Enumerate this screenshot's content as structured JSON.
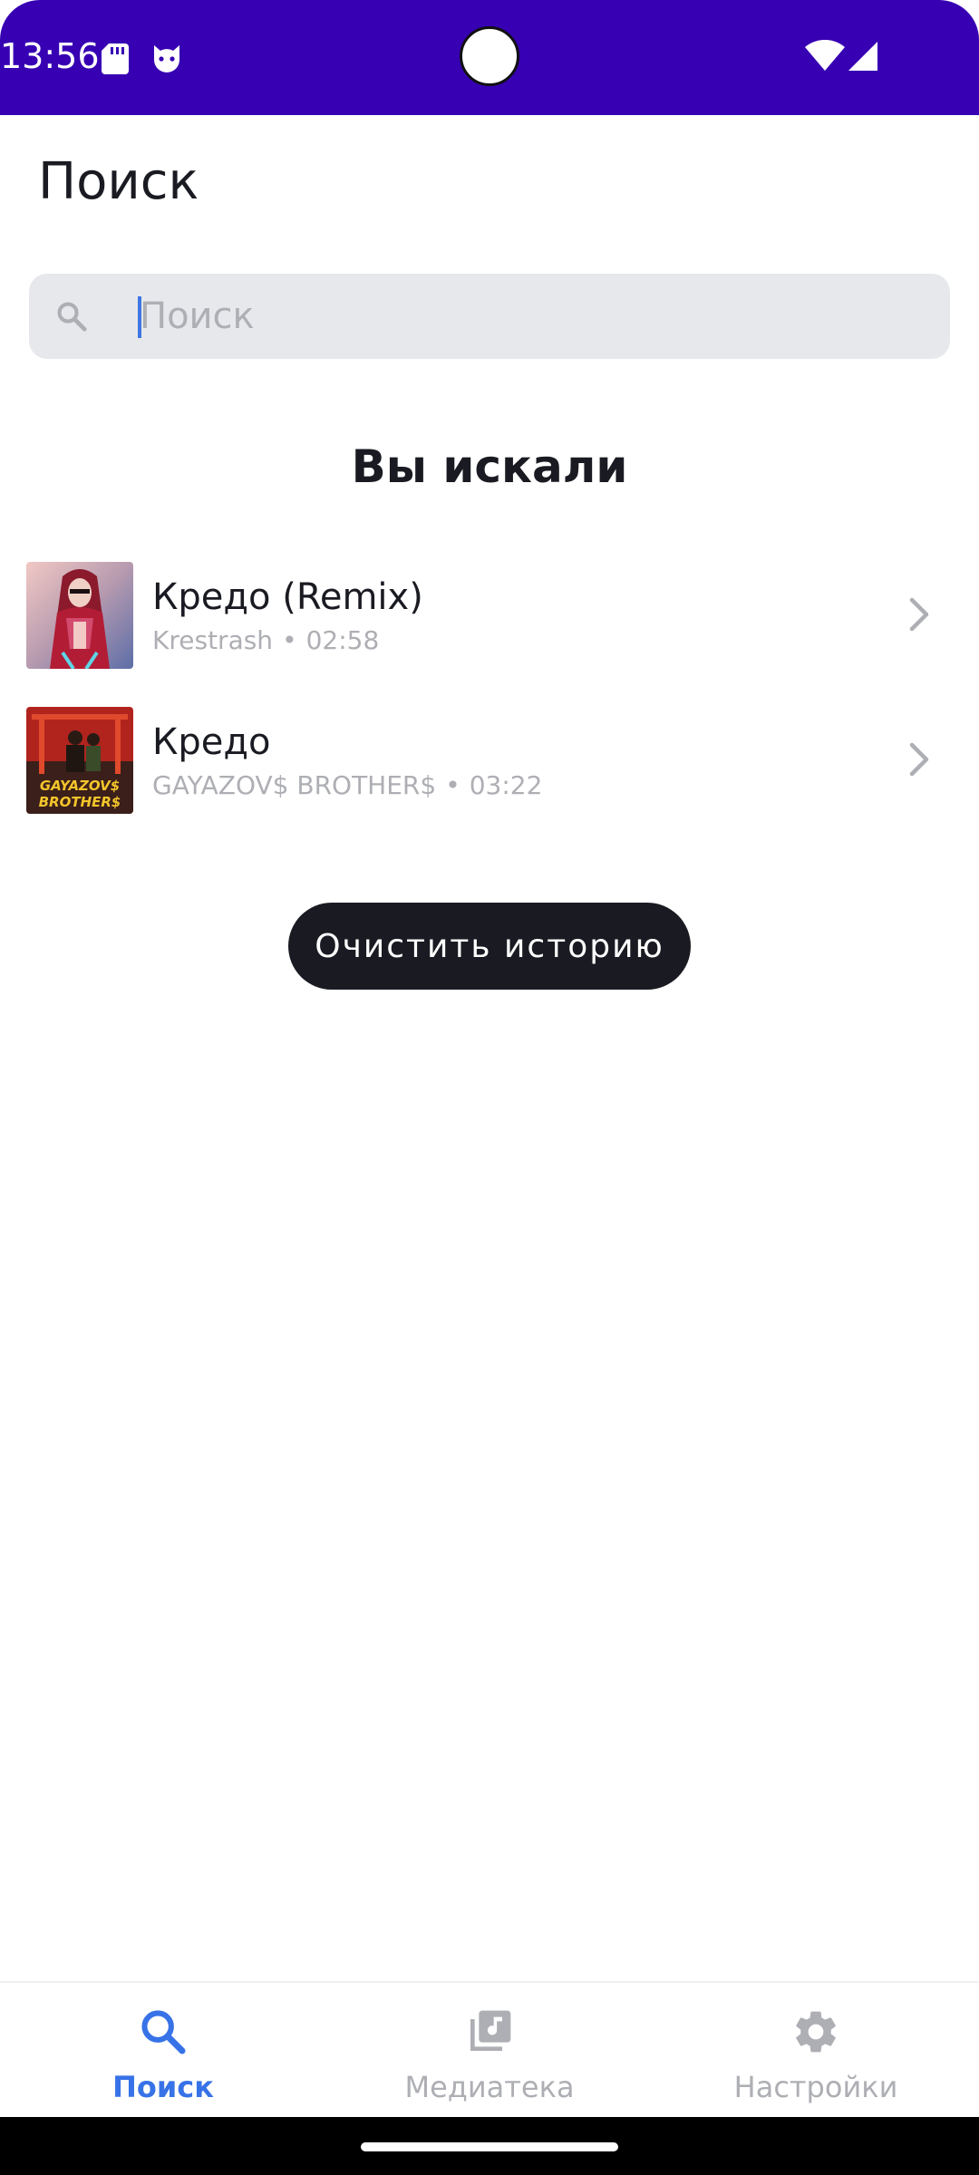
{
  "status_bar": {
    "time": "13:56",
    "icons": [
      "sd-card-icon",
      "cat-icon",
      "wifi-icon",
      "signal-icon"
    ],
    "background": "#3700b3"
  },
  "header": {
    "title": "Поиск"
  },
  "search": {
    "placeholder": "Поиск",
    "value": ""
  },
  "history": {
    "title": "Вы искали",
    "tracks": [
      {
        "name": "Кредо (Remix)",
        "artist": "Krestrash",
        "duration": "02:58",
        "separator": "•"
      },
      {
        "name": "Кредо",
        "artist": "GAYAZOV$ BROTHER$",
        "duration": "03:22",
        "separator": "•",
        "cover_text_1": "GAYAZOV$",
        "cover_text_2": "BROTHER$"
      }
    ],
    "clear_label": "Очистить историю"
  },
  "bottom_nav": {
    "items": [
      {
        "label": "Поиск",
        "icon": "search-icon",
        "active": true
      },
      {
        "label": "Медиатека",
        "icon": "library-icon",
        "active": false
      },
      {
        "label": "Настройки",
        "icon": "gear-icon",
        "active": false
      }
    ]
  },
  "colors": {
    "accent": "#3772e7",
    "text_primary": "#1a1b22",
    "text_secondary": "#aeafb4",
    "search_background": "#e6e8eb",
    "button_background": "#1a1b22"
  }
}
